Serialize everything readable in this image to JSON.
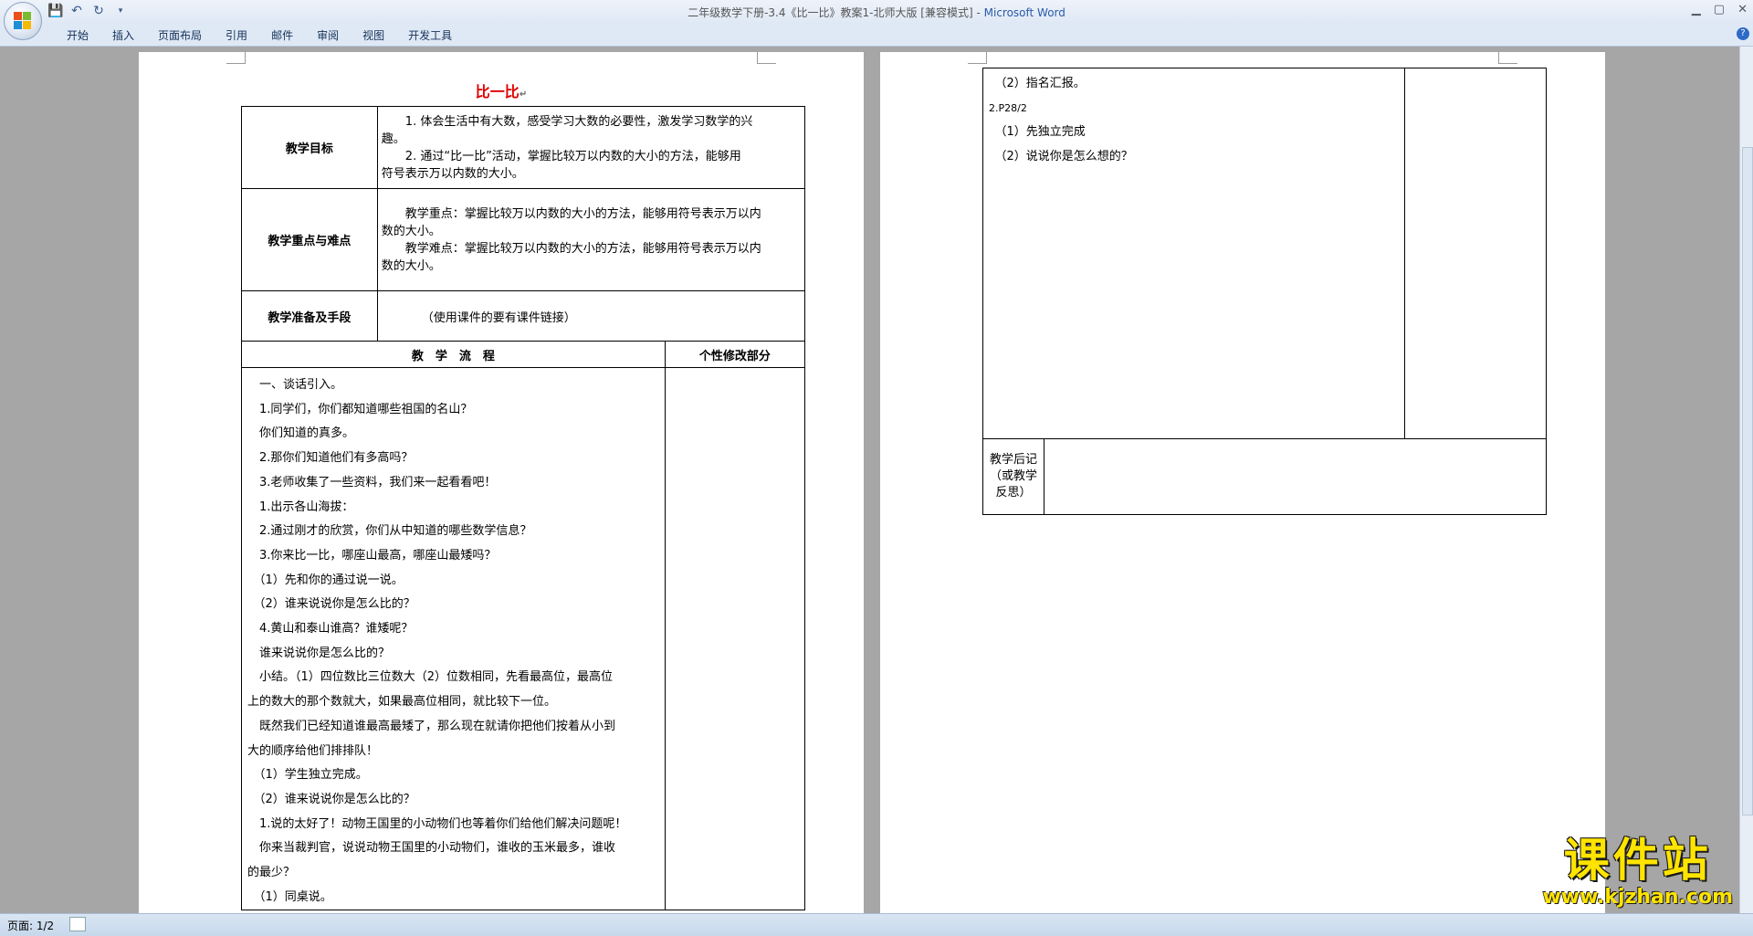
{
  "window": {
    "title": "二年级数学下册-3.4《比一比》教案1-北师大版 [兼容模式] - ",
    "app": "Microsoft Word"
  },
  "tabs": [
    "开始",
    "插入",
    "页面布局",
    "引用",
    "邮件",
    "审阅",
    "视图",
    "开发工具"
  ],
  "status": {
    "page": "页面: 1/2"
  },
  "doc": {
    "title": "比一比",
    "goals_label": "教学目标",
    "goals": [
      "　　1. 体会生活中有大数，感受学习大数的必要性，激发学习数学的兴",
      "趣。",
      "　　2. 通过“比一比”活动，掌握比较万以内数的大小的方法，能够用",
      "符号表示万以内数的大小。"
    ],
    "key_label": "教学重点与难点",
    "key": [
      "　　教学重点：掌握比较万以内数的大小的方法，能够用符号表示万以内",
      "数的大小。",
      "　　教学难点：掌握比较万以内数的大小的方法，能够用符号表示万以内",
      "数的大小。"
    ],
    "prep_label": "教学准备及手段",
    "prep": "（使用课件的要有课件链接）",
    "flow_label": "教　学　流　程",
    "personal_label": "个性修改部分",
    "flow": [
      "　一、谈话引入。",
      "　1.同学们，你们都知道哪些祖国的名山？",
      "　你们知道的真多。",
      "　2.那你们知道他们有多高吗？",
      "　3.老师收集了一些资料，我们来一起看看吧！",
      "　1.出示各山海拔：",
      "　2.通过刚才的欣赏，你们从中知道的哪些数学信息？",
      "　3.你来比一比，哪座山最高，哪座山最矮吗？",
      "　（1）先和你的通过说一说。",
      "　（2）谁来说说你是怎么比的？",
      "　4.黄山和泰山谁高？谁矮呢？",
      "　谁来说说你是怎么比的？",
      "　小结。（1）四位数比三位数大（2）位数相同，先看最高位，最高位",
      "上的数大的那个数就大，如果最高位相同，就比较下一位。",
      "　既然我们已经知道谁最高最矮了，那么现在就请你把他们按着从小到",
      "大的顺序给他们排排队！",
      "　（1）学生独立完成。",
      "　（2）谁来说说你是怎么比的？",
      "　1.说的太好了！动物王国里的小动物们也等着你们给他们解决问题呢！",
      "　你来当裁判官，说说动物王国里的小动物们，谁收的玉米最多，谁收",
      "的最少？",
      "　（1）同桌说。"
    ],
    "page2_flow": [
      "　（2）指名汇报。",
      "2.P28/2",
      "　（1）先独立完成",
      "　（2）说说你是怎么想的？"
    ],
    "after_label": "教学后记（或教学反思）"
  },
  "watermark": {
    "main": "课件站",
    "url": "www.kjzhan.com"
  }
}
